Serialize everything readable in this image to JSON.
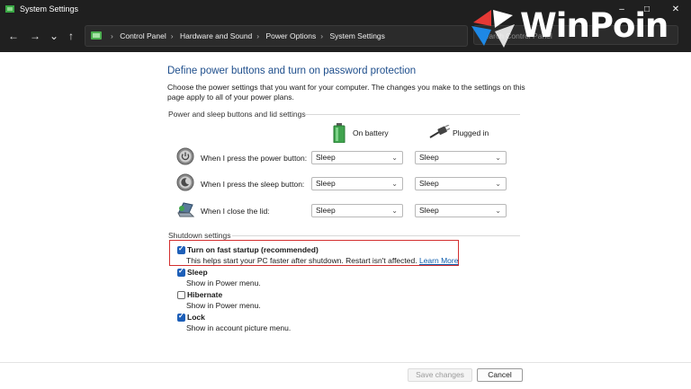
{
  "window": {
    "title": "System Settings",
    "minimize_glyph": "–",
    "maximize_glyph": "□",
    "close_glyph": "✕"
  },
  "nav": {
    "back": "←",
    "forward": "→",
    "recent": "⌄",
    "up": "↑"
  },
  "address": {
    "crumbs": [
      "Control Panel",
      "Hardware and Sound",
      "Power Options",
      "System Settings"
    ],
    "separator": "›",
    "dropdown": "⌄",
    "refresh": "⟳"
  },
  "search": {
    "placeholder": "Search Control Panel"
  },
  "watermark": {
    "text": "WinPoin"
  },
  "page": {
    "heading": "Define power buttons and turn on password protection",
    "description": "Choose the power settings that you want for your computer. The changes you make to the settings on this page apply to all of your power plans."
  },
  "power_section": {
    "title": "Power and sleep buttons and lid settings",
    "col_battery": "On battery",
    "col_plugged": "Plugged in",
    "rows": [
      {
        "label": "When I press the power button:",
        "battery": "Sleep",
        "plugged": "Sleep"
      },
      {
        "label": "When I press the sleep button:",
        "battery": "Sleep",
        "plugged": "Sleep"
      },
      {
        "label": "When I close the lid:",
        "battery": "Sleep",
        "plugged": "Sleep"
      }
    ]
  },
  "shutdown_section": {
    "title": "Shutdown settings",
    "options": [
      {
        "label": "Turn on fast startup (recommended)",
        "desc": "This helps start your PC faster after shutdown. Restart isn't affected.",
        "link": "Learn More",
        "checked": true
      },
      {
        "label": "Sleep",
        "desc": "Show in Power menu.",
        "checked": true
      },
      {
        "label": "Hibernate",
        "desc": "Show in Power menu.",
        "checked": false
      },
      {
        "label": "Lock",
        "desc": "Show in account picture menu.",
        "checked": true
      }
    ]
  },
  "footer": {
    "save": "Save changes",
    "cancel": "Cancel"
  },
  "colors": {
    "accent": "#1d5fb8",
    "heading": "#1e4e8c",
    "highlight": "#d32f2f",
    "titlebar": "#1f1f1f"
  }
}
